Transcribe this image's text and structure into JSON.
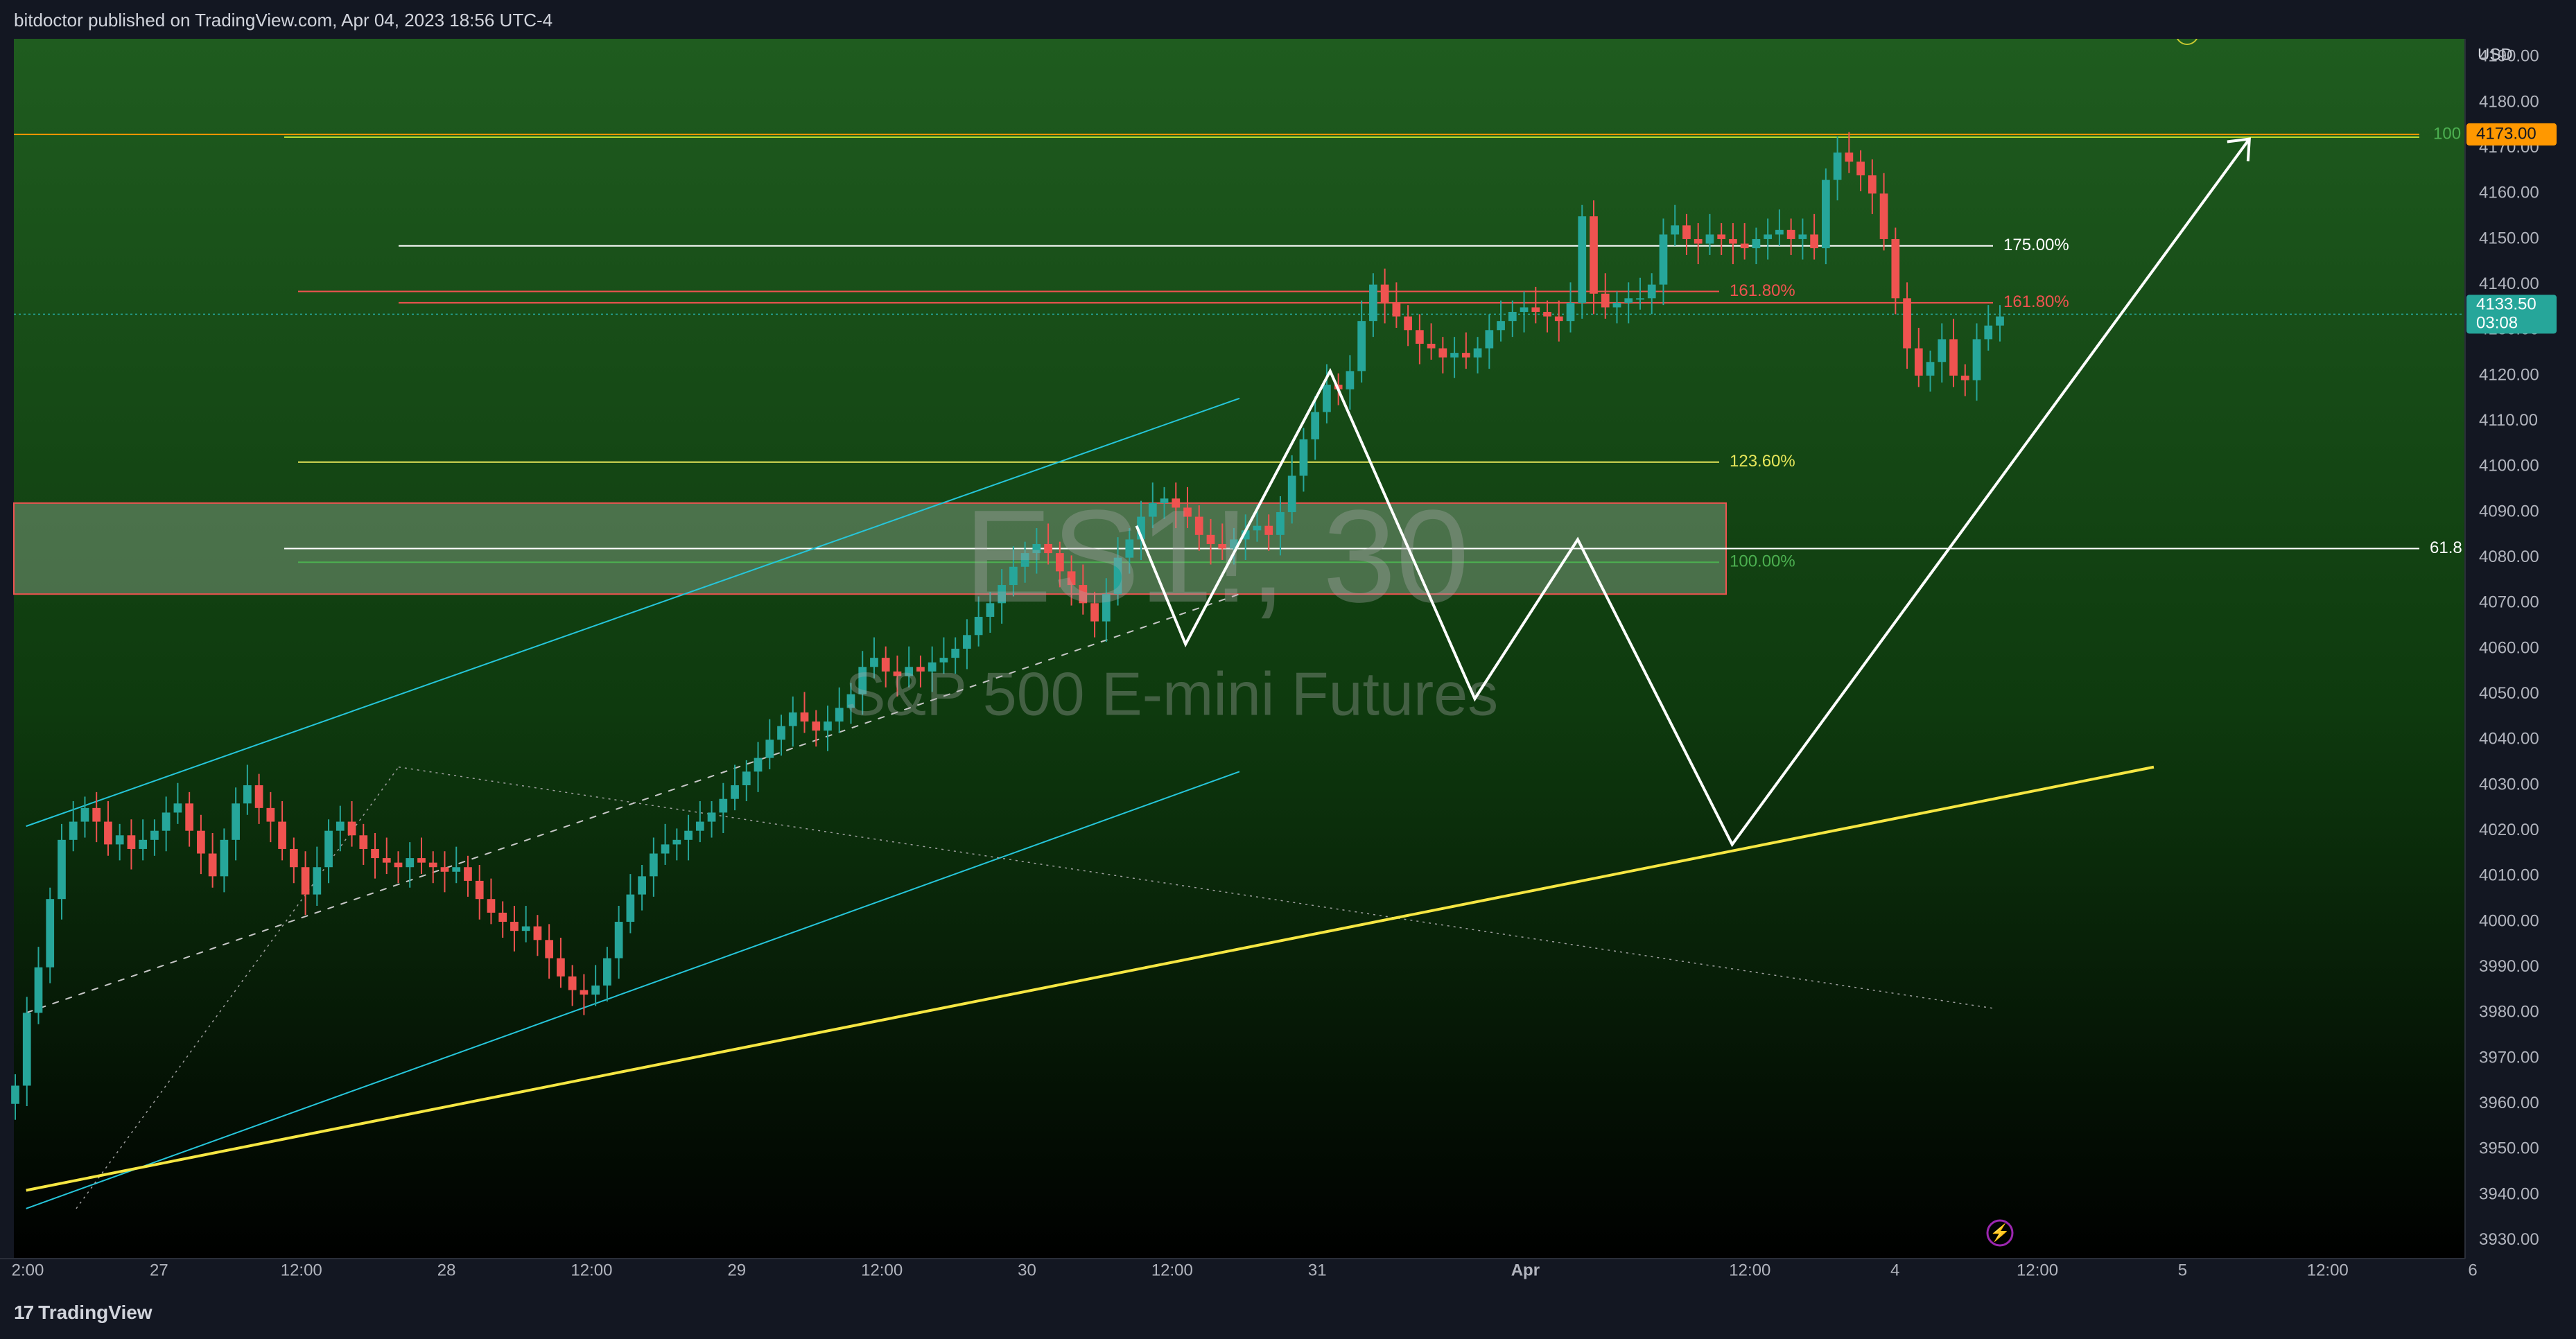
{
  "header": {
    "published_by": "bitdoctor published on TradingView.com, Apr 04, 2023 18:56 UTC-4"
  },
  "footer": {
    "brand": "TradingView",
    "brand_mark": "17"
  },
  "colors": {
    "bg_top": "#1e5a1e",
    "bg_bottom": "#000000",
    "axis_bg": "#131722",
    "up": "#26a69a",
    "down": "#ef5350",
    "fib_white": "#ffffff",
    "fib_red": "#ef5350",
    "fib_yellow": "#e6e65a",
    "fib_green": "#4caf50",
    "channel": "#26c6da",
    "trendline": "#f5e642",
    "price_badge": "#26a69a",
    "target_badge": "#ff9800"
  },
  "chart_data": {
    "type": "candlestick",
    "symbol": "ES1!, 30",
    "description": "S&P 500 E-mini Futures",
    "currency": "USD",
    "y_ticks": [
      4190,
      4180,
      4170,
      4160,
      4150,
      4140,
      4130,
      4120,
      4110,
      4100,
      4090,
      4080,
      4070,
      4060,
      4050,
      4040,
      4030,
      4020,
      4010,
      4000,
      3990,
      3980,
      3970,
      3960,
      3950,
      3940,
      3930
    ],
    "ylim": [
      3926,
      4194
    ],
    "x_tick_labels": [
      "2:00",
      "27",
      "12:00",
      "28",
      "12:00",
      "29",
      "12:00",
      "30",
      "12:00",
      "31",
      "Apr",
      "12:00",
      "4",
      "12:00",
      "5",
      "12:00",
      "6"
    ],
    "current_price": "4133.50",
    "countdown": "03:08",
    "target_price": "4173.00",
    "fib_levels": [
      {
        "label": "175.00%",
        "value": 4148.5,
        "color": "white"
      },
      {
        "label": "161.80%",
        "value": 4138.5,
        "color": "red"
      },
      {
        "label": "161.80%",
        "value": 4136,
        "color": "red"
      },
      {
        "label": "123.60%",
        "value": 4101,
        "color": "yellow"
      },
      {
        "label": "100.00%",
        "value": 4079,
        "color": "green"
      },
      {
        "label": "61.8",
        "value": 4082,
        "color": "white"
      },
      {
        "label": "100",
        "value": 4173,
        "color": "green"
      }
    ],
    "zone": {
      "high": 4092,
      "low": 4072
    },
    "path_points": [
      [
        0.458,
        4087
      ],
      [
        0.478,
        4061
      ],
      [
        0.537,
        4121
      ],
      [
        0.596,
        4049
      ],
      [
        0.638,
        4084
      ],
      [
        0.701,
        4017
      ],
      [
        0.912,
        4172
      ]
    ],
    "main_trendline": [
      [
        0.005,
        3941
      ],
      [
        0.873,
        4034
      ]
    ],
    "channel_upper": [
      [
        0.005,
        4021
      ],
      [
        0.5,
        4115
      ]
    ],
    "channel_lower": [
      [
        0.005,
        3937
      ],
      [
        0.5,
        4033
      ]
    ],
    "candles_close": [
      3964,
      3980,
      3990,
      4005,
      4018,
      4022,
      4025,
      4022,
      4017,
      4019,
      4016,
      4018,
      4020,
      4024,
      4026,
      4020,
      4015,
      4010,
      4018,
      4026,
      4030,
      4025,
      4022,
      4016,
      4012,
      4006,
      4012,
      4020,
      4022,
      4019,
      4016,
      4014,
      4013,
      4012,
      4014,
      4013,
      4012,
      4011,
      4012,
      4009,
      4005,
      4002,
      4000,
      3998,
      3999,
      3996,
      3992,
      3988,
      3985,
      3984,
      3986,
      3992,
      4000,
      4006,
      4010,
      4015,
      4017,
      4018,
      4020,
      4022,
      4024,
      4027,
      4030,
      4033,
      4036,
      4040,
      4043,
      4046,
      4044,
      4042,
      4044,
      4047,
      4050,
      4056,
      4058,
      4055,
      4054,
      4056,
      4055,
      4057,
      4058,
      4060,
      4063,
      4067,
      4070,
      4074,
      4078,
      4081,
      4083,
      4081,
      4077,
      4074,
      4070,
      4066,
      4072,
      4080,
      4084,
      4089,
      4092,
      4093,
      4091,
      4089,
      4085,
      4083,
      4082,
      4084,
      4086,
      4087,
      4085,
      4090,
      4098,
      4106,
      4112,
      4118,
      4117,
      4121,
      4132,
      4140,
      4136,
      4133,
      4130,
      4127,
      4126,
      4124,
      4125,
      4124,
      4126,
      4130,
      4132,
      4134,
      4135,
      4134,
      4133,
      4132,
      4136,
      4155,
      4138,
      4135,
      4136,
      4137,
      4137,
      4140,
      4151,
      4153,
      4150,
      4149,
      4151,
      4150,
      4149,
      4148,
      4150,
      4151,
      4152,
      4150,
      4151,
      4148,
      4163,
      4169,
      4167,
      4164,
      4160,
      4150,
      4137,
      4126,
      4120,
      4123,
      4128,
      4120,
      4119,
      4128,
      4131,
      4133
    ]
  }
}
